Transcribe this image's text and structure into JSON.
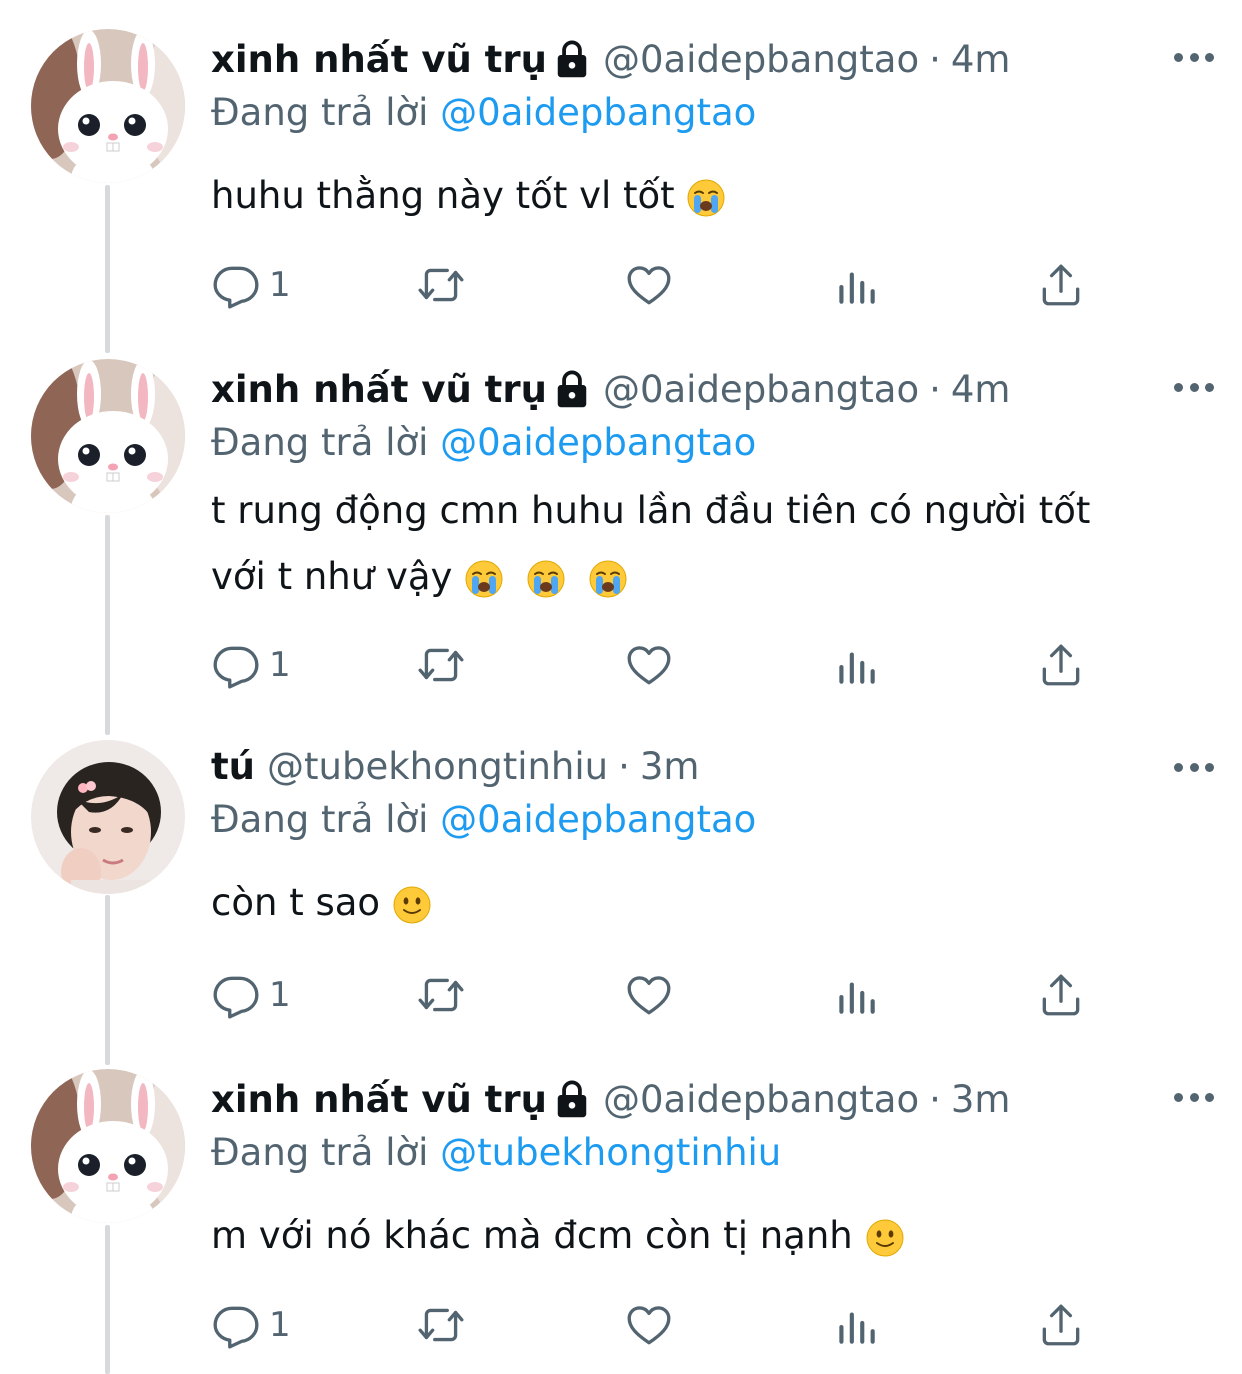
{
  "tweets": [
    {
      "name": "xinh nhất vũ trụ",
      "handle": "@0aidepbangtao",
      "sep": "·",
      "time": "4m",
      "reply_prefix": "Đang trả lời",
      "reply_to": "@0aidepbangtao",
      "text": "huhu thằng này tốt vl tốt",
      "emoji": [
        "loudly-crying-face"
      ],
      "reply_count": "1",
      "locked": true,
      "avatar": "white-rabbit-avatar"
    },
    {
      "name": "xinh nhất vũ trụ",
      "handle": "@0aidepbangtao",
      "sep": "·",
      "time": "4m",
      "reply_prefix": "Đang trả lời",
      "reply_to": "@0aidepbangtao",
      "text_line1": "t rung động cmn huhu lần đầu tiên có người tốt",
      "text_line2": "với t như vậy",
      "emoji": [
        "loudly-crying-face",
        "loudly-crying-face",
        "loudly-crying-face"
      ],
      "reply_count": "1",
      "locked": true,
      "avatar": "white-rabbit-avatar"
    },
    {
      "name": "tú",
      "handle": "@tubekhongtinhiu",
      "sep": "·",
      "time": "3m",
      "reply_prefix": "Đang trả lời",
      "reply_to": "@0aidepbangtao",
      "text": "còn t sao",
      "emoji": [
        "slightly-smiling-face"
      ],
      "reply_count": "1",
      "locked": false,
      "avatar": "person-photo-avatar"
    },
    {
      "name": "xinh nhất vũ trụ",
      "handle": "@0aidepbangtao",
      "sep": "·",
      "time": "3m",
      "reply_prefix": "Đang trả lời",
      "reply_to": "@tubekhongtinhiu",
      "text": "m với nó khác mà đcm còn tị nạnh",
      "emoji": [
        "slightly-smiling-face"
      ],
      "reply_count": "1",
      "locked": true,
      "avatar": "white-rabbit-avatar"
    }
  ],
  "colors": {
    "text": "#0f1419",
    "secondary": "#536471",
    "link": "#1d9bf0",
    "thread_line": "#d7dadd"
  },
  "icons": [
    "reply-icon",
    "retweet-icon",
    "like-icon",
    "analytics-icon",
    "share-icon",
    "more-icon",
    "lock-icon"
  ]
}
